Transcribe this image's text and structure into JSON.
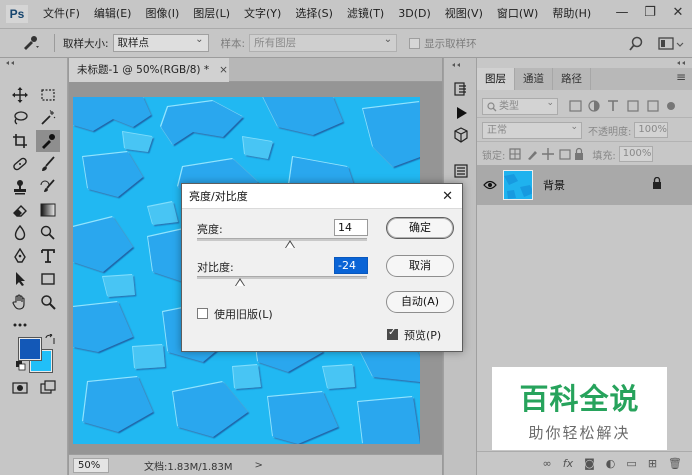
{
  "app": {
    "logo": "Ps",
    "menu": [
      "文件(F)",
      "编辑(E)",
      "图像(I)",
      "图层(L)",
      "文字(Y)",
      "选择(S)",
      "滤镜(T)",
      "3D(D)",
      "视图(V)",
      "窗口(W)",
      "帮助(H)"
    ],
    "window_controls": {
      "minimize": "—",
      "maximize": "❐",
      "close": "✕"
    }
  },
  "options_bar": {
    "tool_icon": "eyedropper-icon",
    "sample_size_label": "取样大小:",
    "sample_size_value": "取样点",
    "sample_label": "样本:",
    "sample_value": "所有图层",
    "show_ring_label": "显示取样环",
    "show_ring_checked": false
  },
  "document": {
    "tab_title": "未标题-1 @ 50%(RGB/8) *",
    "tab_close": "×",
    "zoom": "50%",
    "doc_info": "文档:1.83M/1.83M",
    "status_arrow": ">"
  },
  "colors": {
    "foreground": "#1358b7",
    "background": "#21bff8",
    "canvas_base": "#21b8f2"
  },
  "layers_panel": {
    "tabs": [
      "图层",
      "通道",
      "路径"
    ],
    "active_tab": "图层",
    "filter_label": "类型",
    "blend_mode": "正常",
    "opacity_label": "不透明度:",
    "opacity_value": "100%",
    "lock_label": "锁定:",
    "fill_label": "填充:",
    "fill_value": "100%",
    "layers": [
      {
        "name": "背景",
        "visible": true,
        "locked": true
      }
    ],
    "bottom_icons": [
      "link-icon",
      "fx-icon",
      "mask-icon",
      "adjustment-icon",
      "group-icon",
      "new-layer-icon",
      "delete-icon"
    ]
  },
  "dialog": {
    "title": "亮度/对比度",
    "close": "✕",
    "brightness_label": "亮度:",
    "brightness_value": "14",
    "contrast_label": "对比度:",
    "contrast_value": "-24",
    "legacy_label": "使用旧版(L)",
    "legacy_checked": false,
    "ok_label": "确定",
    "cancel_label": "取消",
    "auto_label": "自动(A)",
    "preview_label": "预览(P)",
    "preview_checked": true
  },
  "watermark": {
    "main": "百科全说",
    "sub": "助你轻松解决"
  }
}
